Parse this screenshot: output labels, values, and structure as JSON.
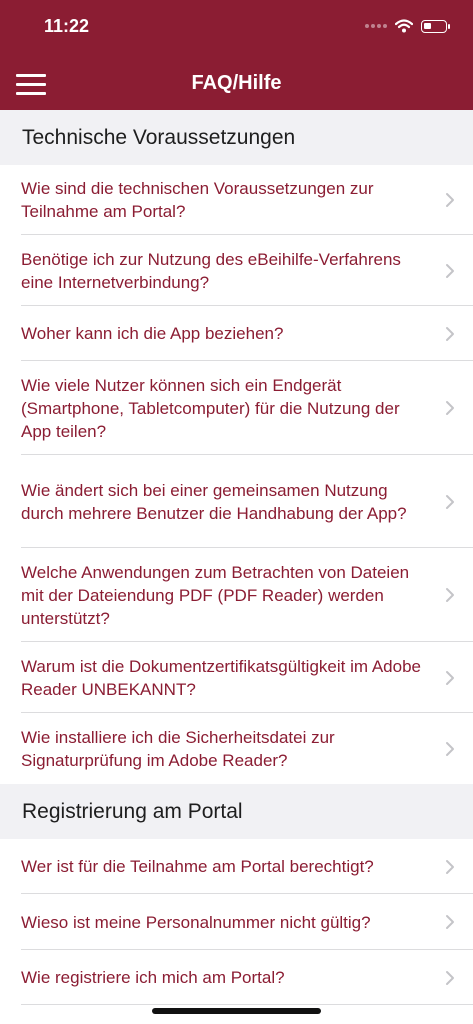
{
  "status_bar": {
    "time": "11:22"
  },
  "header": {
    "title": "FAQ/Hilfe",
    "menu_icon": "hamburger-menu-icon"
  },
  "sections": [
    {
      "title": "Technische Voraussetzungen",
      "items": [
        "Wie sind die technischen Voraussetzungen zur Teilnahme am Portal?",
        "Benötige ich zur Nutzung des eBeihilfe-Verfahrens eine Internetverbindung?",
        "Woher kann ich die App beziehen?",
        "Wie viele Nutzer können sich ein Endgerät (Smartphone, Tabletcomputer) für die Nutzung der App teilen?",
        "Wie ändert sich bei einer gemeinsamen Nutzung durch mehrere Benutzer die Handhabung der App?",
        "Welche Anwendungen zum Betrachten von Dateien mit der Dateiendung PDF (PDF Reader) werden unterstützt?",
        "Warum ist die Dokumentzertifikatsgültigkeit im Adobe Reader UNBEKANNT?",
        "Wie installiere ich die Sicherheitsdatei zur Signaturprüfung im Adobe Reader?"
      ]
    },
    {
      "title": "Registrierung am Portal",
      "items": [
        "Wer ist für die Teilnahme am Portal berechtigt?",
        "Wieso ist meine Personalnummer nicht gültig?",
        "Wie registriere ich mich am Portal?"
      ]
    }
  ],
  "colors": {
    "brand": "#8b1d33",
    "section_bg": "#f1f1f4",
    "link_text": "#8b1d33"
  }
}
